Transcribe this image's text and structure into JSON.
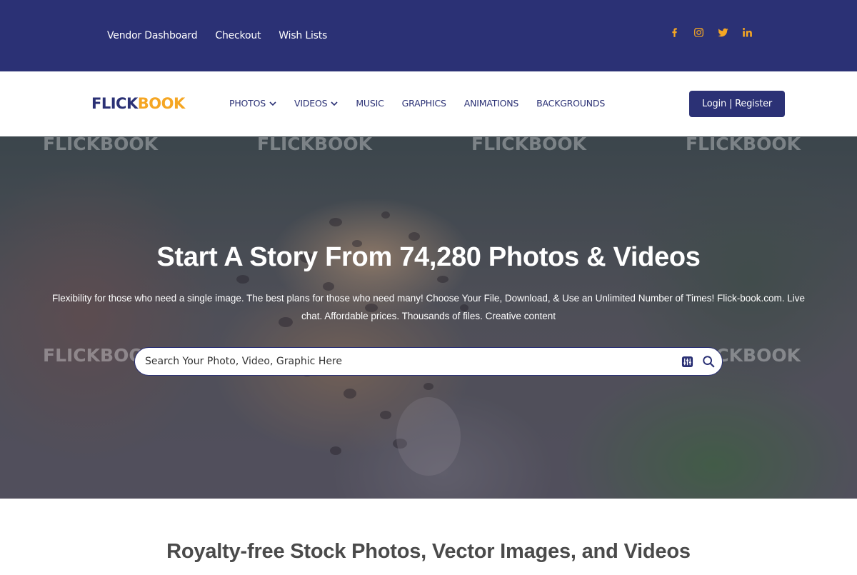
{
  "topbar": {
    "links": [
      "Vendor Dashboard",
      "Checkout",
      "Wish Lists"
    ],
    "social_icons": [
      "facebook-icon",
      "instagram-icon",
      "twitter-icon",
      "linkedin-icon"
    ],
    "bg_color": "#2b3175",
    "accent_color": "#f5a623"
  },
  "nav": {
    "logo": {
      "part1": "FLICK",
      "part2": "BOOK"
    },
    "menu": [
      {
        "label": "PHOTOS",
        "has_dropdown": true
      },
      {
        "label": "VIDEOS",
        "has_dropdown": true
      },
      {
        "label": "MUSIC",
        "has_dropdown": false
      },
      {
        "label": "GRAPHICS",
        "has_dropdown": false
      },
      {
        "label": "ANIMATIONS",
        "has_dropdown": false
      },
      {
        "label": "BACKGROUNDS",
        "has_dropdown": false
      }
    ],
    "login_label": "Login | Register"
  },
  "hero": {
    "title": "Start A Story From 74,280 Photos & Videos",
    "subtitle": "Flexibility for those who need a single image. The best plans for those who need many! Choose Your File, Download, & Use an Unlimited Number of Times! Flick-book.com. Live chat. Affordable prices. Thousands of files. Creative content",
    "search_placeholder": "Search Your Photo, Video, Graphic Here",
    "watermark": "FLICKBOOK"
  },
  "section": {
    "heading": "Royalty-free Stock Photos, Vector Images, and Videos"
  }
}
